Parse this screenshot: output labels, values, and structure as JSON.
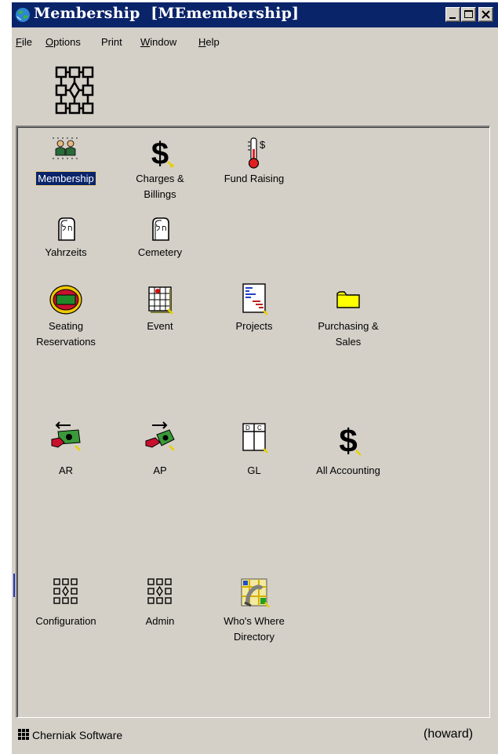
{
  "window": {
    "title": "Membership  [MEmembership]",
    "controls": [
      "minimize",
      "maximize",
      "close"
    ]
  },
  "menu": {
    "items": [
      {
        "label": "File",
        "underline": "F",
        "rest": "ile"
      },
      {
        "label": "Options",
        "underline": "O",
        "rest": "ptions"
      },
      {
        "label": "Print",
        "underline": "",
        "rest": "Print"
      },
      {
        "label": "Window",
        "underline": "W",
        "rest": "indow"
      },
      {
        "label": "Help",
        "underline": "H",
        "rest": "elp"
      }
    ]
  },
  "apps": {
    "membership": {
      "line1": "Membership",
      "line2": "",
      "icon": "people-icon",
      "selected": true
    },
    "charges": {
      "line1": "Charges &",
      "line2": "Billings",
      "icon": "dollar-icon"
    },
    "fundraising": {
      "line1": "Fund Raising",
      "line2": "",
      "icon": "thermometer-icon"
    },
    "yahrzeits": {
      "line1": "Yahrzeits",
      "line2": "",
      "icon": "tablet-icon"
    },
    "cemetery": {
      "line1": "Cemetery",
      "line2": "",
      "icon": "tablet-icon"
    },
    "seating": {
      "line1": "Seating",
      "line2": "Reservations",
      "icon": "stadium-icon"
    },
    "event": {
      "line1": "Event",
      "line2": "",
      "icon": "calendar-icon"
    },
    "projects": {
      "line1": "Projects",
      "line2": "",
      "icon": "gantt-icon"
    },
    "purchasing": {
      "line1": "Purchasing &",
      "line2": "Sales",
      "icon": "folder-icon"
    },
    "ar": {
      "line1": "AR",
      "line2": "",
      "icon": "money-in-icon"
    },
    "ap": {
      "line1": "AP",
      "line2": "",
      "icon": "money-out-icon"
    },
    "gl": {
      "line1": "GL",
      "line2": "",
      "icon": "ledger-icon"
    },
    "allaccounting": {
      "line1": "All Accounting",
      "line2": "",
      "icon": "dollar-icon"
    },
    "configuration": {
      "line1": "Configuration",
      "line2": "",
      "icon": "flowchart-icon"
    },
    "admin": {
      "line1": "Admin",
      "line2": "",
      "icon": "flowchart-icon"
    },
    "whoswhere": {
      "line1": "Who's Where",
      "line2": "Directory",
      "icon": "phone-map-icon"
    }
  },
  "status": {
    "company": "Cherniak Software",
    "user": "(howard)"
  },
  "colors": {
    "titlebar": "#0a246a",
    "face": "#d4d0c8",
    "selection": "#0a246a"
  }
}
